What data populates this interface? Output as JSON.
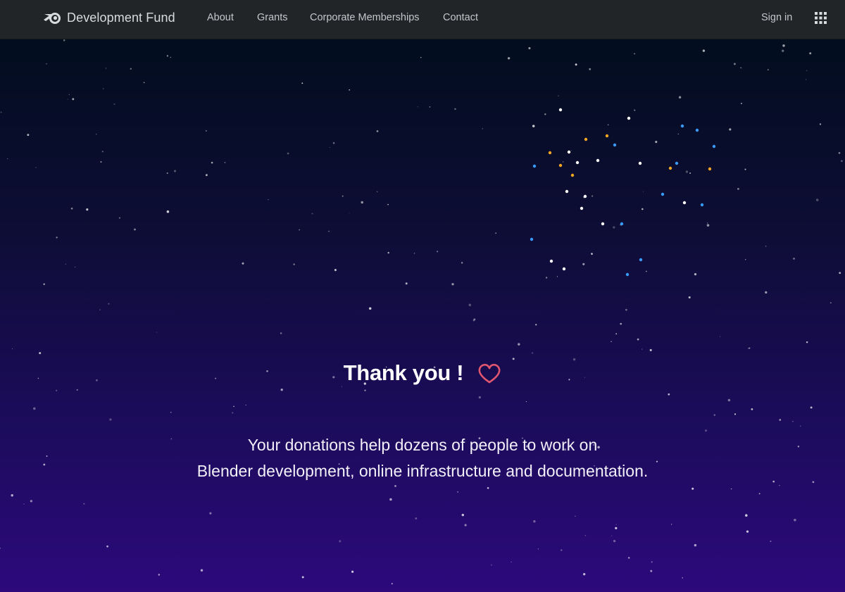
{
  "navbar": {
    "brand": {
      "icon": "blender-logo-icon",
      "label": "Development Fund"
    },
    "links": {
      "about": "About",
      "grants": "Grants",
      "corporate_memberships": "Corporate Memberships",
      "contact": "Contact"
    },
    "sign_in": "Sign in",
    "apps_icon": "grid-apps-icon"
  },
  "hero": {
    "title": "Thank you !",
    "heart_icon": "heart-outline-icon",
    "message_line1": "Your donations help dozens of people to work on",
    "message_line2": "Blender development, online infrastructure and documentation."
  },
  "colors": {
    "navbar_bg": "#222528",
    "gradient_top": "#020d1e",
    "gradient_bottom": "#2d097c",
    "heart": "#e0566e",
    "text_light": "#ffffff"
  }
}
